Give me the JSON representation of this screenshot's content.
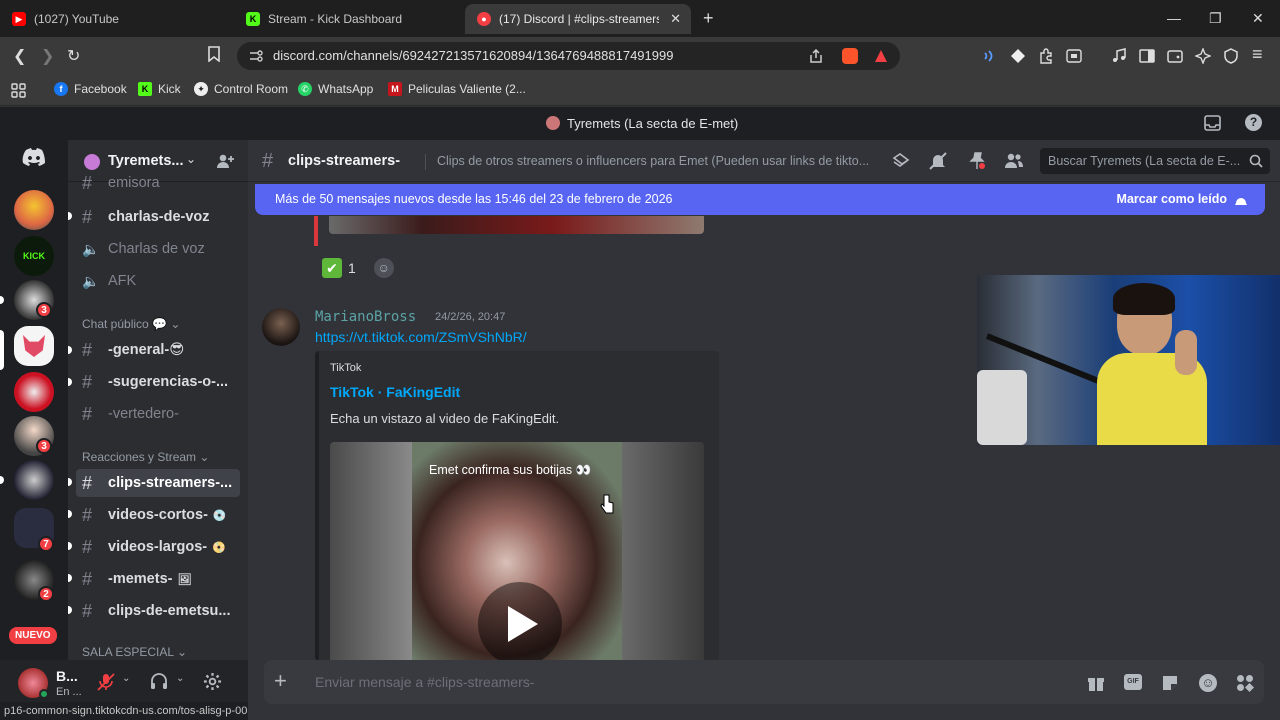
{
  "browser": {
    "tabs": [
      {
        "title": "(1027) YouTube",
        "favicon_color": "#ff0000"
      },
      {
        "title": "Stream - Kick Dashboard",
        "favicon_color": "#53fc18"
      },
      {
        "title": "(17) Discord | #clips-streamers-\u0001",
        "favicon_color": "#f23f43",
        "active": true
      }
    ],
    "url": "discord.com/channels/692427213571620894/1364769488817491999",
    "bookmarks": [
      "Facebook",
      "Kick",
      "Control Room",
      "WhatsApp",
      "Peliculas Valiente (2..."
    ],
    "status_url": "p16-common-sign.tiktokcdn-us.com/tos-alisg-p-0037/.../play-icon-large.png:::::jp..."
  },
  "discord": {
    "window_title": "Tyremets (La secta de E-met)",
    "server_name": "Tyremets...",
    "channels": [
      {
        "label": "emisora",
        "muted": true,
        "type": "text"
      },
      {
        "label": "charlas-de-voz",
        "type": "text"
      },
      {
        "label": "Charlas de voz",
        "muted": true,
        "type": "voice"
      },
      {
        "label": "AFK",
        "muted": true,
        "type": "voice"
      },
      {
        "category": "Chat público"
      },
      {
        "label": "-general-😎",
        "type": "text"
      },
      {
        "label": "-sugerencias-o-...",
        "type": "text"
      },
      {
        "label": "-vertedero-",
        "muted": true,
        "type": "text"
      },
      {
        "category": "Reacciones y Stream"
      },
      {
        "label": "clips-streamers-...",
        "active": true,
        "type": "text"
      },
      {
        "label": "videos-cortos-",
        "type": "text"
      },
      {
        "label": "videos-largos-",
        "type": "text"
      },
      {
        "label": "-memets-",
        "type": "text"
      },
      {
        "label": "clips-de-emetsu...",
        "type": "text"
      },
      {
        "category": "SALA ESPECIAL"
      }
    ],
    "server_badges": [
      "3",
      "3",
      "7",
      "2"
    ],
    "nuevo_label": "NUEVO",
    "user": {
      "name": "B...",
      "status": "En ..."
    },
    "channel_header": {
      "name": "clips-streamers-",
      "topic": "Clips de otros streamers o influencers para Emet (Pueden usar links de tikto...",
      "search_placeholder": "Buscar Tyremets (La secta de E-..."
    },
    "new_messages_bar": {
      "text": "Más de 50 mensajes nuevos desde las 15:46 del 23 de febrero de 2026",
      "action": "Marcar como leído"
    },
    "reaction": {
      "emoji": "✅",
      "count": "1"
    },
    "message": {
      "author": "MarianoBross",
      "timestamp": "24/2/26, 20:47",
      "link": "https://vt.tiktok.com/ZSmVShNbR/",
      "embed": {
        "provider": "TikTok",
        "title": "TikTok · FaKingEdit",
        "description": "Echa un vistazo al video de FaKingEdit.",
        "video_caption": "Emet confirma sus botijas 👀"
      }
    },
    "composer_placeholder": "Enviar mensaje a #clips-streamers-"
  }
}
